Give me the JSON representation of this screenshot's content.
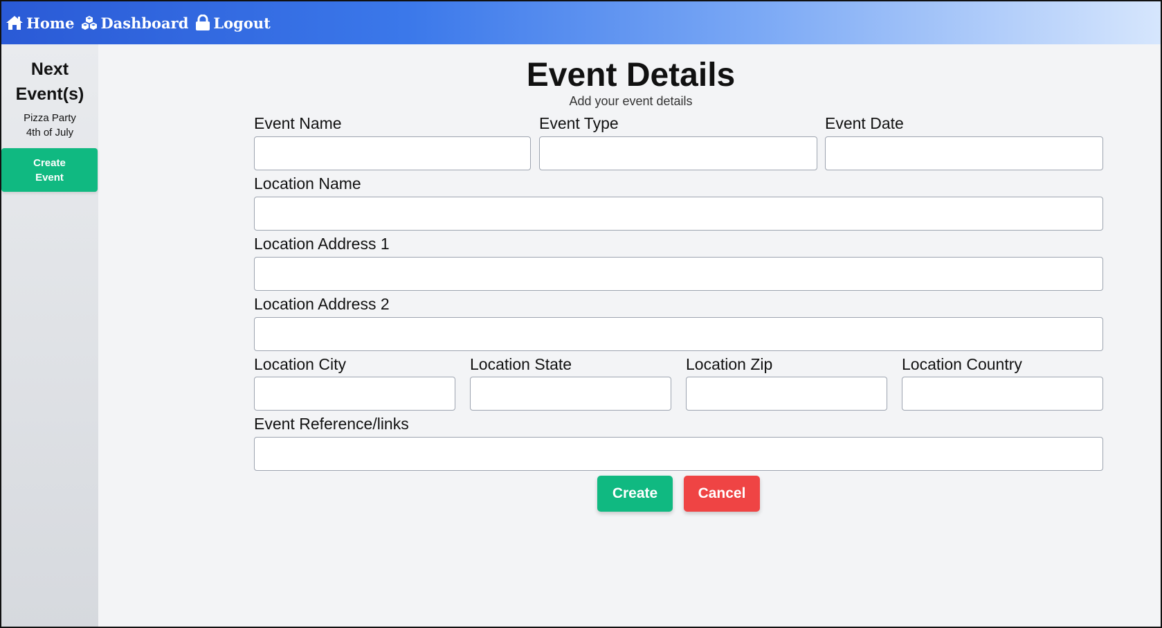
{
  "nav": {
    "home_label": "Home",
    "dashboard_label": "Dashboard",
    "logout_label": "Logout"
  },
  "sidebar": {
    "heading_line1": "Next",
    "heading_line2": "Event(s)",
    "events": [
      "Pizza Party",
      "4th of July"
    ],
    "create_line1": "Create",
    "create_line2": "Event"
  },
  "form": {
    "title": "Event Details",
    "subtitle": "Add your event details",
    "fields": {
      "event_name": {
        "label": "Event Name",
        "value": ""
      },
      "event_type": {
        "label": "Event Type",
        "value": ""
      },
      "event_date": {
        "label": "Event Date",
        "value": ""
      },
      "location_name": {
        "label": "Location Name",
        "value": ""
      },
      "location_address1": {
        "label": "Location Address 1",
        "value": ""
      },
      "location_address2": {
        "label": "Location Address 2",
        "value": ""
      },
      "location_city": {
        "label": "Location City",
        "value": ""
      },
      "location_state": {
        "label": "Location State",
        "value": ""
      },
      "location_zip": {
        "label": "Location Zip",
        "value": ""
      },
      "location_country": {
        "label": "Location Country",
        "value": ""
      },
      "event_reference": {
        "label": "Event Reference/links",
        "value": ""
      }
    },
    "create_label": "Create",
    "cancel_label": "Cancel"
  },
  "colors": {
    "primary": "#10b981",
    "danger": "#ef4444",
    "nav_start": "#2a5ad6",
    "nav_end": "#d6e6fd"
  }
}
